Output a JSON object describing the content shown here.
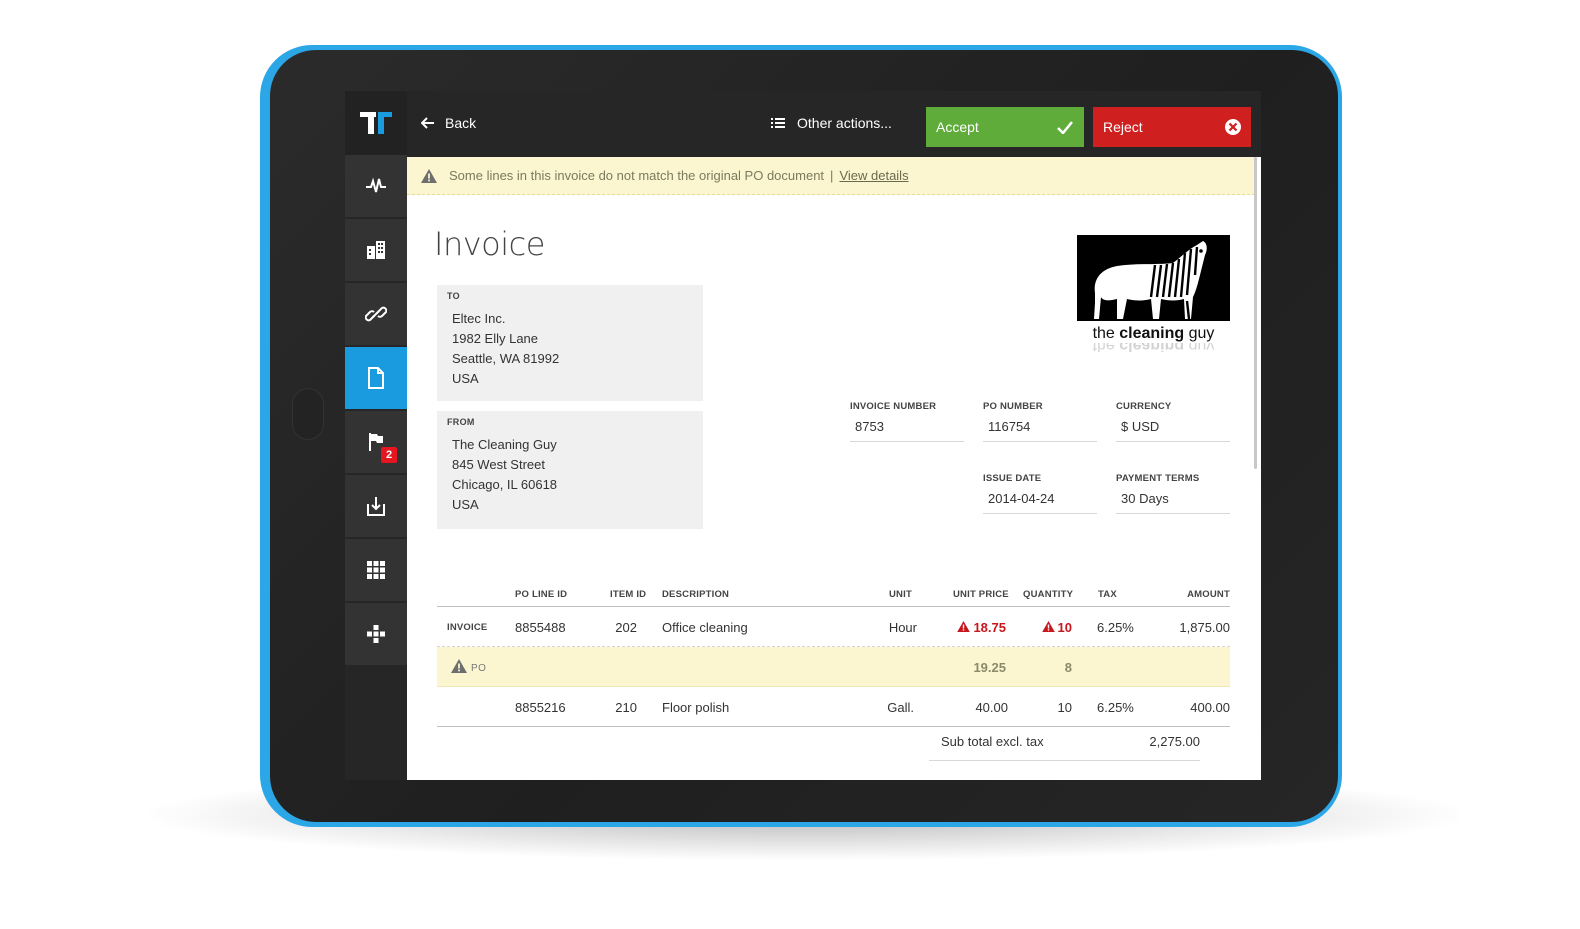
{
  "topbar": {
    "back_label": "Back",
    "other_actions_label": "Other actions...",
    "accept_label": "Accept",
    "reject_label": "Reject"
  },
  "sidebar": {
    "items": [
      {
        "icon": "activity-icon"
      },
      {
        "icon": "building-icon"
      },
      {
        "icon": "link-icon"
      },
      {
        "icon": "document-icon",
        "active": true
      },
      {
        "icon": "flag-icon",
        "badge": "2"
      },
      {
        "icon": "inbox-download-icon"
      },
      {
        "icon": "grid-icon"
      },
      {
        "icon": "puzzle-icon"
      }
    ]
  },
  "banner": {
    "message": "Some lines in this invoice do not match the original PO document",
    "separator": "|",
    "link": "View details"
  },
  "invoice": {
    "title": "Invoice",
    "to": {
      "label": "TO",
      "lines": [
        "Eltec Inc.",
        "1982 Elly Lane",
        "Seattle, WA 81992",
        "USA"
      ]
    },
    "from": {
      "label": "FROM",
      "lines": [
        "The Cleaning Guy",
        "845 West Street",
        "Chicago, IL 60618",
        "USA"
      ]
    },
    "logo": {
      "prefix": "the ",
      "bold": "cleaning",
      "suffix": " guy"
    },
    "fields": {
      "invoice_number": {
        "label": "INVOICE NUMBER",
        "value": "8753"
      },
      "po_number": {
        "label": "PO NUMBER",
        "value": "116754"
      },
      "currency": {
        "label": "CURRENCY",
        "value": "$ USD"
      },
      "issue_date": {
        "label": "ISSUE DATE",
        "value": "2014-04-24"
      },
      "payment_terms": {
        "label": "PAYMENT TERMS",
        "value": "30 Days"
      }
    }
  },
  "table": {
    "headers": {
      "po_line_id": "PO LINE ID",
      "item_id": "ITEM ID",
      "description": "DESCRIPTION",
      "unit": "UNIT",
      "unit_price": "UNIT PRICE",
      "quantity": "QUANTITY",
      "tax": "TAX",
      "amount": "AMOUNT"
    },
    "rows": [
      {
        "label": "INVOICE",
        "po_line_id": "8855488",
        "item_id": "202",
        "description": "Office cleaning",
        "unit": "Hour",
        "unit_price": "18.75",
        "quantity": "10",
        "tax": "6.25%",
        "amount": "1,875.00"
      },
      {
        "label": "PO",
        "unit_price": "19.25",
        "quantity": "8"
      },
      {
        "label": "",
        "po_line_id": "8855216",
        "item_id": "210",
        "description": "Floor polish",
        "unit": "Gall.",
        "unit_price": "40.00",
        "quantity": "10",
        "tax": "6.25%",
        "amount": "400.00"
      }
    ],
    "subtotal": {
      "label": "Sub total excl. tax",
      "value": "2,275.00"
    }
  },
  "colors": {
    "accent_blue": "#1a9be0",
    "accept_green": "#5fac3b",
    "reject_red": "#cf1f1f",
    "warning_bg": "#fbf6d0",
    "tablet_frame": "#2ba6e6"
  }
}
